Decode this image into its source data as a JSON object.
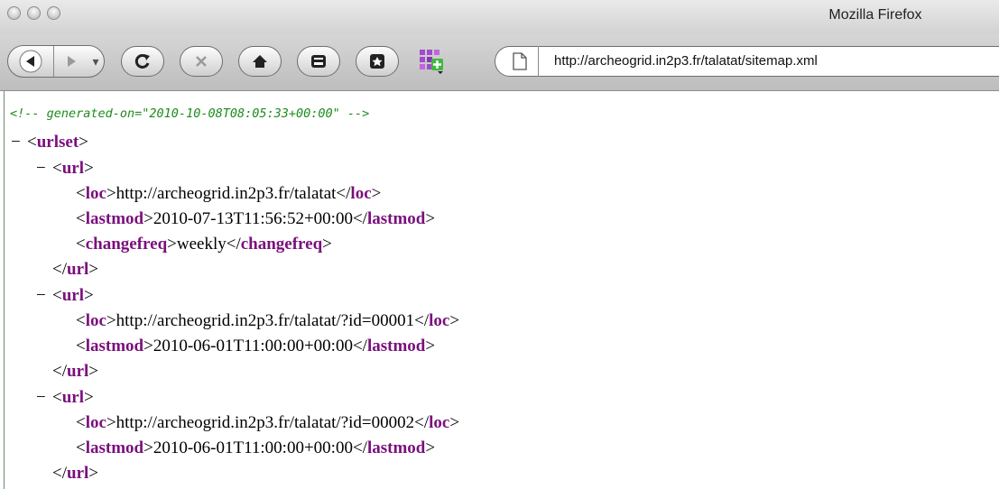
{
  "window": {
    "title": "Mozilla Firefox"
  },
  "toolbar": {
    "url": "http://archeogrid.in2p3.fr/talatat/sitemap.xml",
    "buttons": [
      "back-icon",
      "forward-icon",
      "reload-icon",
      "stop-icon",
      "home-icon",
      "download-icon",
      "bookmark-icon",
      "addon-icon"
    ]
  },
  "xml": {
    "comment": "<!-- generated-on=\"2010-10-08T08:05:33+00:00\" -->",
    "collapse": "−",
    "urlset_tag": "urlset",
    "url_tag": "url",
    "loc_tag": "loc",
    "lastmod_tag": "lastmod",
    "changefreq_tag": "changefreq",
    "entries": [
      {
        "loc": "http://archeogrid.in2p3.fr/talatat",
        "lastmod": "2010-07-13T11:56:52+00:00",
        "changefreq": "weekly"
      },
      {
        "loc": "http://archeogrid.in2p3.fr/talatat/?id=00001",
        "lastmod": "2010-06-01T11:00:00+00:00"
      },
      {
        "loc": "http://archeogrid.in2p3.fr/talatat/?id=00002",
        "lastmod": "2010-06-01T11:00:00+00:00"
      }
    ]
  }
}
